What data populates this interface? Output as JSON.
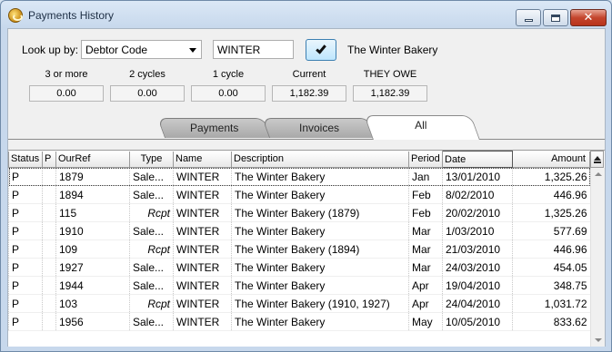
{
  "window": {
    "title": "Payments History"
  },
  "lookup": {
    "label": "Look up by:",
    "field": "Debtor Code",
    "value": "WINTER",
    "debtor_name": "The Winter Bakery"
  },
  "aging": [
    {
      "caption": "3 or more",
      "value": "0.00"
    },
    {
      "caption": "2 cycles",
      "value": "0.00"
    },
    {
      "caption": "1 cycle",
      "value": "0.00"
    },
    {
      "caption": "Current",
      "value": "1,182.39"
    },
    {
      "caption": "THEY OWE",
      "value": "1,182.39"
    }
  ],
  "tabs": [
    {
      "label": "Payments",
      "active": false
    },
    {
      "label": "Invoices",
      "active": false
    },
    {
      "label": "All",
      "active": true
    }
  ],
  "grid": {
    "columns": [
      "Status",
      "P",
      "OurRef",
      "Type",
      "Name",
      "Description",
      "Period",
      "Date",
      "Amount"
    ],
    "rows": [
      [
        "P",
        "",
        "1879",
        "Sale...",
        "WINTER",
        "The Winter Bakery",
        "Jan",
        "13/01/2010",
        "1,325.26"
      ],
      [
        "P",
        "",
        "1894",
        "Sale...",
        "WINTER",
        "The Winter Bakery",
        "Feb",
        "8/02/2010",
        "446.96"
      ],
      [
        "P",
        "",
        "115",
        "Rcpt",
        "WINTER",
        "The Winter Bakery (1879)",
        "Feb",
        "20/02/2010",
        "1,325.26"
      ],
      [
        "P",
        "",
        "1910",
        "Sale...",
        "WINTER",
        "The Winter Bakery",
        "Mar",
        "1/03/2010",
        "577.69"
      ],
      [
        "P",
        "",
        "109",
        "Rcpt",
        "WINTER",
        "The Winter Bakery (1894)",
        "Mar",
        "21/03/2010",
        "446.96"
      ],
      [
        "P",
        "",
        "1927",
        "Sale...",
        "WINTER",
        "The Winter Bakery",
        "Mar",
        "24/03/2010",
        "454.05"
      ],
      [
        "P",
        "",
        "1944",
        "Sale...",
        "WINTER",
        "The Winter Bakery",
        "Apr",
        "19/04/2010",
        "348.75"
      ],
      [
        "P",
        "",
        "103",
        "Rcpt",
        "WINTER",
        "The Winter Bakery (1910, 1927)",
        "Apr",
        "24/04/2010",
        "1,031.72"
      ],
      [
        "P",
        "",
        "1956",
        "Sale...",
        "WINTER",
        "The Winter Bakery",
        "May",
        "10/05/2010",
        "833.62"
      ]
    ]
  }
}
